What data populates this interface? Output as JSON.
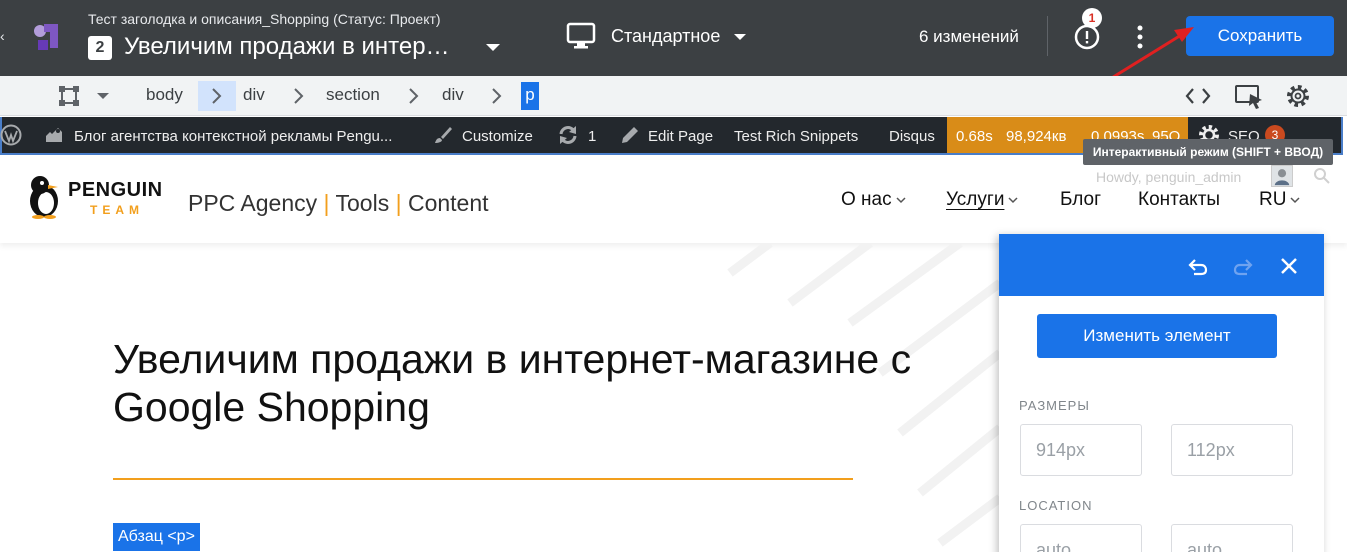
{
  "topbar": {
    "experiment_subtitle": "Тест заголодка и описания_Shopping (Статус: Проект)",
    "experiment_number": "2",
    "experiment_title": "Увеличим продажи в интер…",
    "device_label": "Стандартное",
    "changes_count": "6 изменений",
    "alert_count": "1",
    "save_label": "Сохранить",
    "save_color": "#1a73e8"
  },
  "breadcrumb": {
    "items": [
      "body",
      "div",
      "section",
      "div",
      "p"
    ]
  },
  "wpbar": {
    "site_name": "Блог агентства контекстной рекламы Pengu...",
    "customize": "Customize",
    "updates_count": "1",
    "edit_page": "Edit Page",
    "rich_snippets": "Test Rich Snippets",
    "disqus": "Disqus",
    "perf_time": "0.68s",
    "perf_memory": "98,924кв",
    "perf_query_time": "0.0993s",
    "perf_queries": "95Q",
    "seo_label": "SEO",
    "seo_count": "3"
  },
  "tooltip": "Интерактивный режим (SHIFT + ВВОД)",
  "site": {
    "howdy": "Howdy, penguin_admin",
    "logo_word": "PENGUIN",
    "logo_team": "TEAM",
    "tagline": [
      "PPC Agency",
      "Tools",
      "Content"
    ],
    "tagline_separator": "|",
    "nav": [
      {
        "label": "О нас"
      },
      {
        "label": "Услуги"
      },
      {
        "label": "Блог"
      },
      {
        "label": "Контакты"
      },
      {
        "label": "RU"
      }
    ],
    "accent_color": "#f29f1d"
  },
  "content": {
    "heading": "Увеличим продажи в интернет-магазине с Google Shopping",
    "element_tag": "Абзац <p>"
  },
  "panel": {
    "edit_button": "Изменить элемент",
    "sizes_label": "РАЗМЕРЫ",
    "width_value": "914px",
    "height_value": "112px",
    "location_label": "LOCATION",
    "loc_x": "auto",
    "loc_y": "auto"
  }
}
